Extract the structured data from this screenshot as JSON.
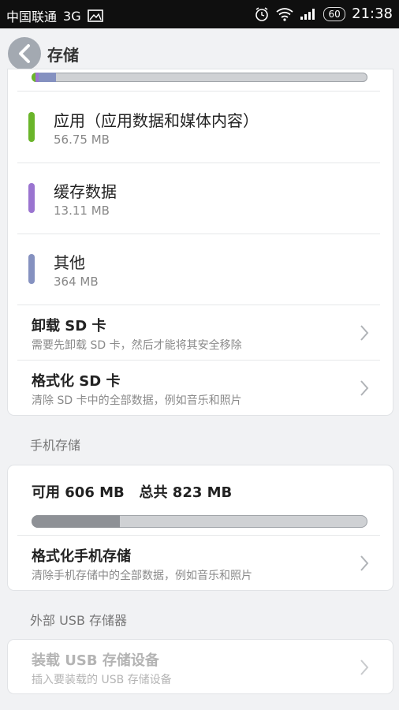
{
  "status_bar": {
    "carrier": "中国联通",
    "network": "3G",
    "battery": "60",
    "time": "21:38"
  },
  "header": {
    "title": "存储"
  },
  "sd_storage": {
    "usage_segments": [
      {
        "label": "应用（应用数据和媒体内容）",
        "color": "#6ab52a",
        "fraction": 0.012
      },
      {
        "label": "缓存数据",
        "color": "#9a74d0",
        "fraction": 0.008
      },
      {
        "label": "其他",
        "color": "#8591c0",
        "fraction": 0.052
      }
    ],
    "items": [
      {
        "title": "应用（应用数据和媒体内容）",
        "size": "56.75 MB",
        "color": "#6ab52a"
      },
      {
        "title": "缓存数据",
        "size": "13.11 MB",
        "color": "#9a74d0"
      },
      {
        "title": "其他",
        "size": "364 MB",
        "color": "#8591c0"
      }
    ],
    "unmount": {
      "title": "卸载 SD 卡",
      "subtitle": "需要先卸载 SD 卡，然后才能将其安全移除"
    },
    "format": {
      "title": "格式化 SD 卡",
      "subtitle": "清除 SD 卡中的全部数据，例如音乐和照片"
    }
  },
  "phone_storage": {
    "header": "手机存储",
    "summary": "可用 606 MB   总共 823 MB",
    "used_fraction": 0.264,
    "format": {
      "title": "格式化手机存储",
      "subtitle": "清除手机存储中的全部数据，例如音乐和照片"
    }
  },
  "usb_storage": {
    "header": "外部 USB 存储器",
    "mount": {
      "title": "装载 USB 存储设备",
      "subtitle": "插入要装载的 USB 存储设备"
    }
  }
}
